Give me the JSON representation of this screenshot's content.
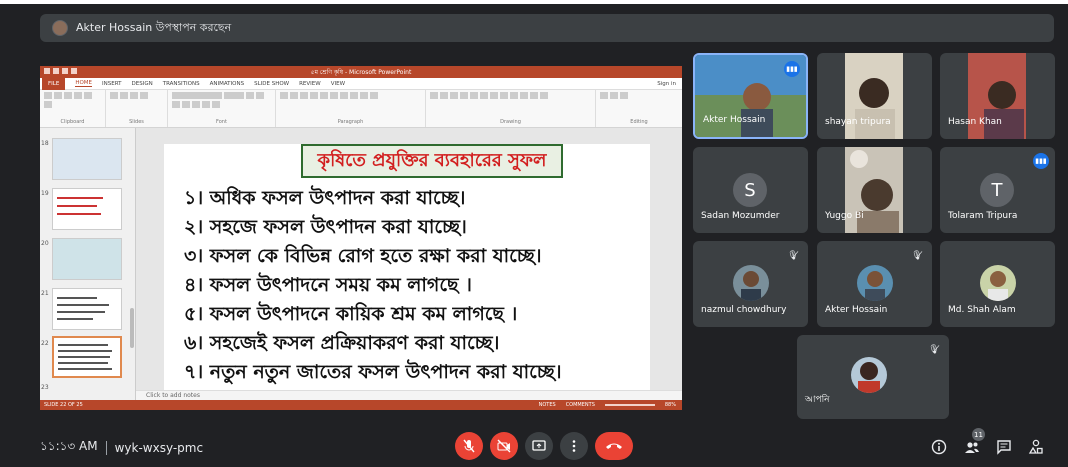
{
  "presenter_bar": {
    "text": "Akter Hossain উপস্থাপন করছেন"
  },
  "powerpoint": {
    "title": "৫ম শ্রেণি কৃষি - Microsoft PowerPoint",
    "tabs": [
      "FILE",
      "HOME",
      "INSERT",
      "DESIGN",
      "TRANSITIONS",
      "ANIMATIONS",
      "SLIDE SHOW",
      "REVIEW",
      "VIEW"
    ],
    "sign_in": "Sign in",
    "ribbon_groups": [
      "Clipboard",
      "Slides",
      "Font",
      "Paragraph",
      "Drawing",
      "Editing"
    ],
    "thumb_numbers": [
      "18",
      "19",
      "20",
      "21",
      "22",
      "23"
    ],
    "notes_placeholder": "Click to add notes",
    "status_left": "SLIDE 22 OF 25",
    "status_notes": "NOTES",
    "status_comments": "COMMENTS",
    "zoom": "88%"
  },
  "slide": {
    "title": "কৃষিতে প্রযুক্তির ব্যবহারের সুফল",
    "items": [
      "১। অধিক ফসল উৎপাদন করা যাচ্ছে।",
      "২। সহজে ফসল উৎপাদন করা যাচ্ছে।",
      "৩। ফসল কে বিভিন্ন রোগ হতে রক্ষা করা যাচ্ছে।",
      "৪। ফসল উৎপাদনে সময় কম লাগছে ।",
      "৫। ফসল উৎপাদনে কায়িক শ্রম কম লাগছে ।",
      "৬। সহজেই ফসল প্রক্রিয়াকরণ করা যাচ্ছে।",
      "৭। নতুন নতুন জাতের ফসল উৎপাদন করা যাচ্ছে।"
    ]
  },
  "participants": [
    {
      "name": "Akter Hossain",
      "kind": "video",
      "speaking": true
    },
    {
      "name": "shayan tripura",
      "kind": "video"
    },
    {
      "name": "Hasan Khan",
      "kind": "video"
    },
    {
      "name": "Sadan Mozumder",
      "kind": "letter",
      "letter": "S",
      "color": "#5f6368"
    },
    {
      "name": "Yuggo Bi",
      "kind": "video"
    },
    {
      "name": "Tolaram Tripura",
      "kind": "letter",
      "letter": "T",
      "color": "#5f6368",
      "speaking": true
    },
    {
      "name": "nazmul chowdhury",
      "kind": "photo",
      "muted": true
    },
    {
      "name": "Akter Hossain",
      "kind": "photo",
      "muted": true
    },
    {
      "name": "Md. Shah Alam",
      "kind": "photo"
    },
    {
      "name": "আপনি",
      "kind": "photo",
      "muted": true
    }
  ],
  "bottom": {
    "time": "১১:১৩ AM",
    "meeting_code": "wyk-wxsy-pmc",
    "people_count": "11"
  },
  "colors": {
    "background": "#202124",
    "tile": "#3c4043",
    "red": "#ea4335",
    "powerpoint": "#b7472a",
    "blue": "#1a73e8"
  }
}
